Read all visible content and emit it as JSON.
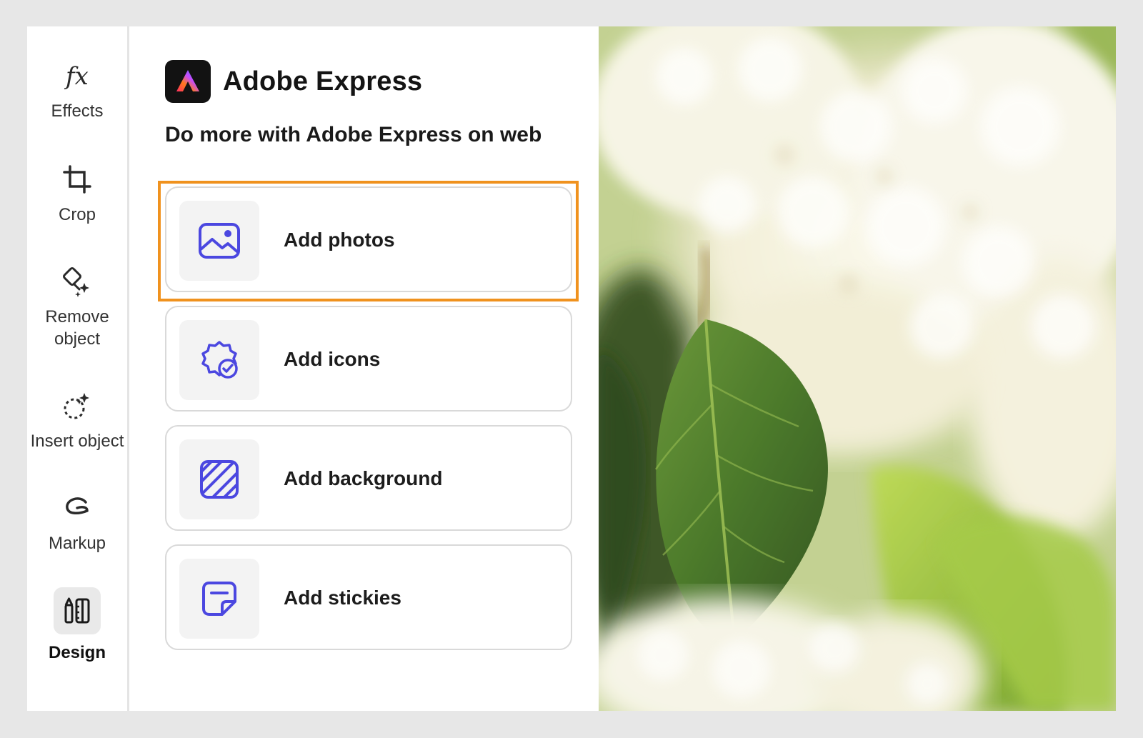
{
  "brand": {
    "name": "Adobe Express",
    "logo_icon": "adobe-express-logo-icon"
  },
  "subtitle": "Do more with Adobe Express on web",
  "rail": {
    "items": [
      {
        "label": "Effects",
        "icon": "fx-icon"
      },
      {
        "label": "Crop",
        "icon": "crop-icon"
      },
      {
        "label": "Remove\nobject",
        "icon": "remove-object-icon"
      },
      {
        "label": "Insert object",
        "icon": "insert-object-icon"
      },
      {
        "label": "Markup",
        "icon": "markup-icon"
      },
      {
        "label": "Design",
        "icon": "design-icon",
        "active": true
      }
    ]
  },
  "cards": [
    {
      "label": "Add photos",
      "icon": "image-icon",
      "highlighted": true
    },
    {
      "label": "Add icons",
      "icon": "icon-badge-icon"
    },
    {
      "label": "Add background",
      "icon": "background-pattern-icon"
    },
    {
      "label": "Add stickies",
      "icon": "sticky-note-icon"
    }
  ],
  "colors": {
    "accent_icon": "#4b47e0",
    "highlight_border": "#f0921e",
    "page_background": "#e7e7e7"
  }
}
